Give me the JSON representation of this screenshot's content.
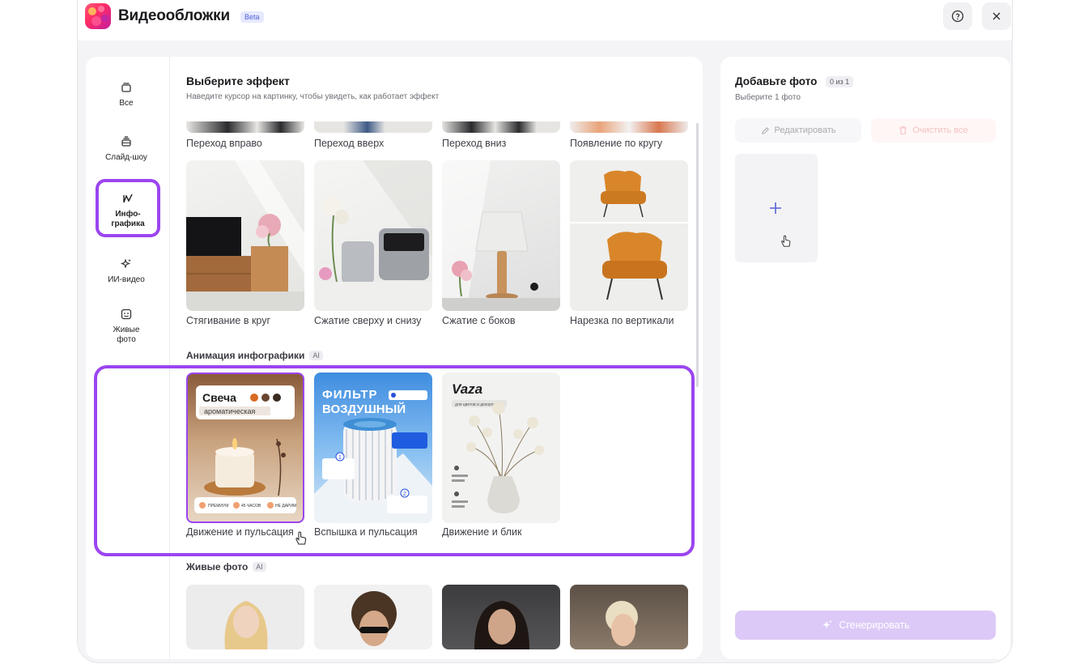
{
  "header": {
    "title": "Видеообложки",
    "badge": "Beta"
  },
  "sidebar": {
    "items": [
      {
        "label": "Все"
      },
      {
        "label": "Слайд-шоу"
      },
      {
        "label": "Инфо-\nграфика"
      },
      {
        "label": "ИИ-видео"
      },
      {
        "label": "Живые\nфото"
      }
    ]
  },
  "main": {
    "title": "Выберите эффект",
    "subtitle": "Наведите курсор на картинку, чтобы увидеть, как работает эффект",
    "top_row": [
      "Переход вправо",
      "Переход вверх",
      "Переход вниз",
      "Появление по кругу"
    ],
    "second_row": [
      "Стягивание в круг",
      "Сжатие сверху и снизу",
      "Сжатие с боков",
      "Нарезка по вертикали"
    ],
    "infographics": {
      "title": "Анимация инфографики",
      "ai": "AI",
      "items": [
        "Движение и пульсация",
        "Вспышка и пульсация",
        "Движение и блик"
      ],
      "card1": {
        "heading": "Свеча",
        "sub": "ароматическая",
        "tag1": "ПРЕМИУМ",
        "tag2": "45 ЧАСОВ",
        "tag3": "НЕ ДАРИМ"
      },
      "card2": {
        "heading1": "ФИЛЬТР",
        "heading2": "ВОЗДУШНЫЙ",
        "n1": "1",
        "n2": "2"
      },
      "card3": {
        "heading": "Vaza",
        "sub": "для цветов и декоров"
      }
    },
    "live": {
      "title": "Живые фото",
      "ai": "AI"
    }
  },
  "right": {
    "title": "Добавьте фото",
    "count": "0 из 1",
    "subtitle": "Выберите 1 фото",
    "edit": "Редактировать",
    "clear": "Очистить все",
    "generate": "Сгенерировать"
  },
  "colors": {
    "accent": "#9b45f0",
    "plus": "#5b63d8"
  }
}
